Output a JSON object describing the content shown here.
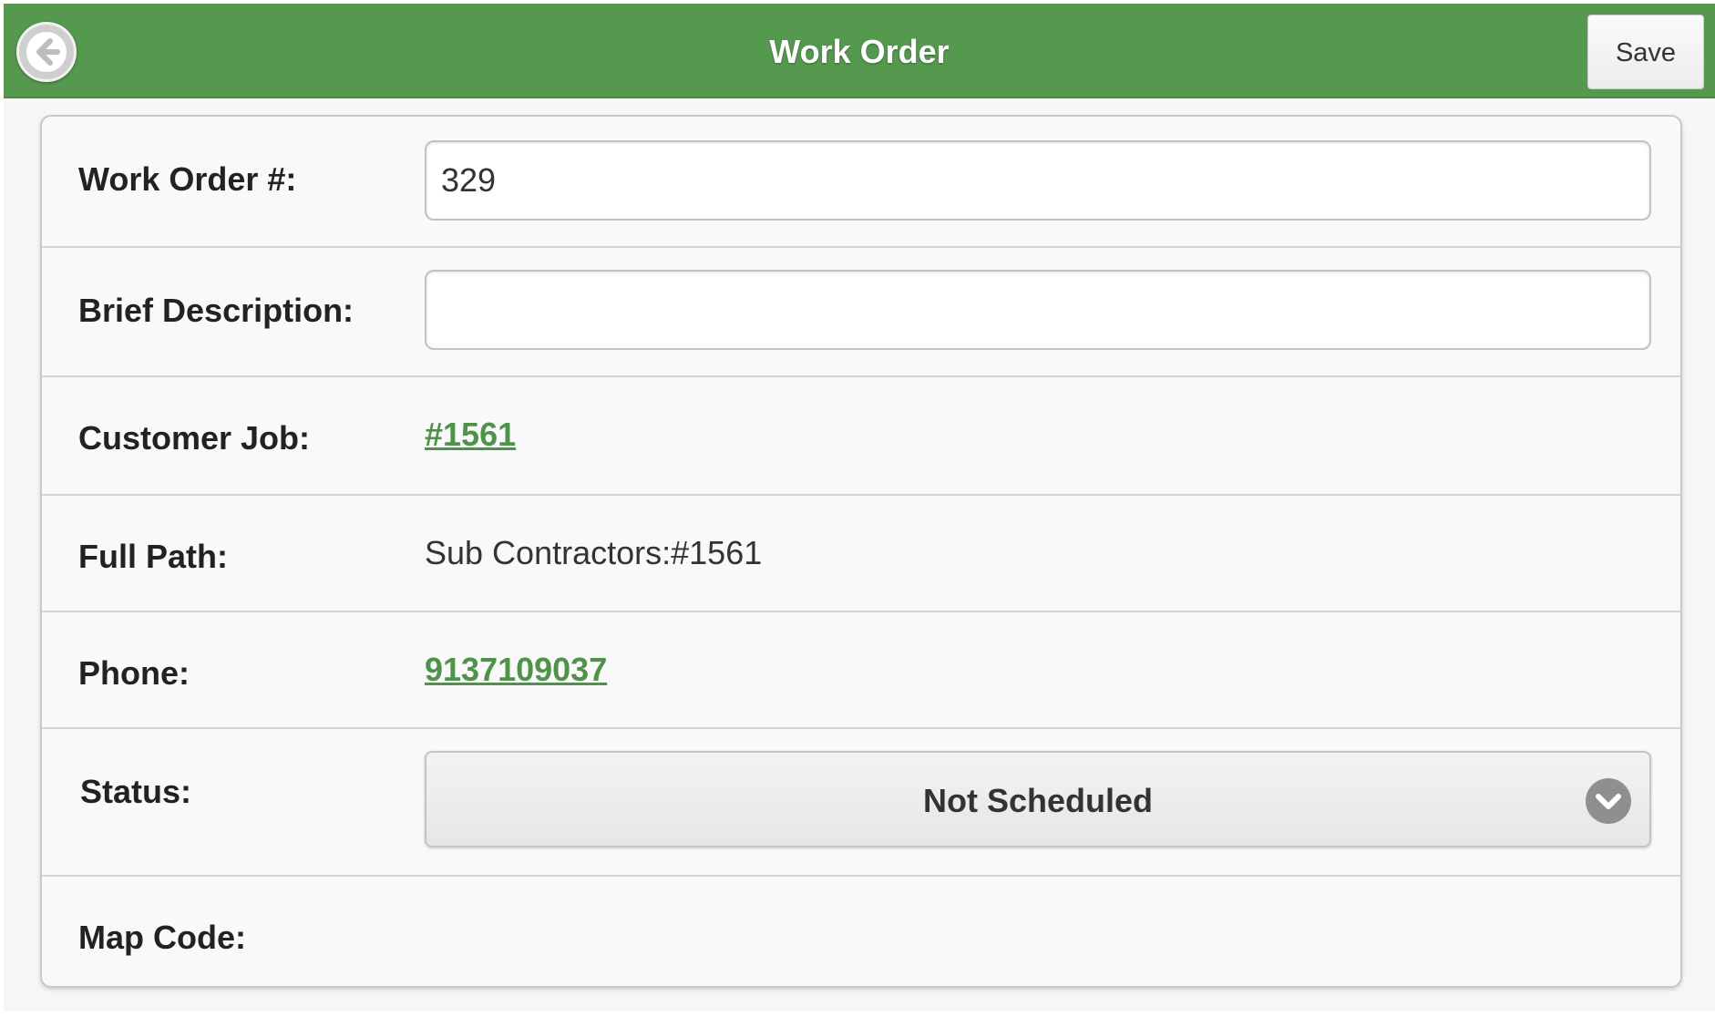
{
  "header": {
    "title": "Work Order",
    "save_label": "Save",
    "back_icon": "back-arrow-icon",
    "bar_color": "#55994f"
  },
  "form": {
    "work_order": {
      "label": "Work Order #:",
      "value": "329"
    },
    "brief_description": {
      "label": "Brief Description:",
      "value": ""
    },
    "customer_job": {
      "label": "Customer Job:",
      "value": "#1561"
    },
    "full_path": {
      "label": "Full Path:",
      "value": "Sub Contractors:#1561"
    },
    "phone": {
      "label": "Phone:",
      "value": "9137109037"
    },
    "status": {
      "label": "Status:",
      "value": "Not Scheduled",
      "icon": "chevron-down-icon"
    },
    "map_code": {
      "label": "Map Code:",
      "value": ""
    }
  },
  "colors": {
    "link": "#4f9249",
    "card_background": "#f9f9f9"
  }
}
